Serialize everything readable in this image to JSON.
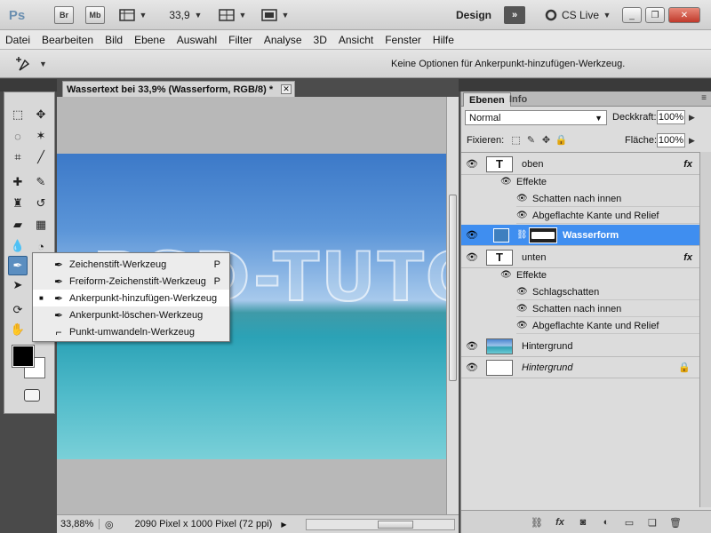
{
  "appbar": {
    "logo": "Ps",
    "bridge": "Br",
    "minibridge": "Mb",
    "zoom": "33,9",
    "workspace": "Design",
    "cslive": "CS Live",
    "minimize": "_",
    "restore": "❐",
    "close": "✕"
  },
  "menu": [
    "Datei",
    "Bearbeiten",
    "Bild",
    "Ebene",
    "Auswahl",
    "Filter",
    "Analyse",
    "3D",
    "Ansicht",
    "Fenster",
    "Hilfe"
  ],
  "options": {
    "text": "Keine Optionen für Ankerpunkt-hinzufügen-Werkzeug."
  },
  "document": {
    "tab_title": "Wassertext bei 33,9% (Wasserform, RGB/8) *",
    "artwork_text": "PSD-TUTO"
  },
  "flyout": [
    {
      "label": "Zeichenstift-Werkzeug",
      "key": "P",
      "icon": "pen-icon"
    },
    {
      "label": "Freiform-Zeichenstift-Werkzeug",
      "key": "P",
      "icon": "freeform-pen-icon"
    },
    {
      "label": "Ankerpunkt-hinzufügen-Werkzeug",
      "key": "",
      "icon": "add-anchor-icon"
    },
    {
      "label": "Ankerpunkt-löschen-Werkzeug",
      "key": "",
      "icon": "delete-anchor-icon"
    },
    {
      "label": "Punkt-umwandeln-Werkzeug",
      "key": "",
      "icon": "convert-point-icon"
    }
  ],
  "status": {
    "zoom": "33,88%",
    "info": "2090 Pixel x 1000 Pixel (72 ppi)"
  },
  "layers_panel": {
    "tab_layers": "Ebenen",
    "tab_info": "Info",
    "blend_mode": "Normal",
    "opacity_label": "Deckkraft:",
    "opacity_value": "100%",
    "lock_label": "Fixieren:",
    "fill_label": "Fläche:",
    "fill_value": "100%",
    "layers": {
      "oben": "oben",
      "effects_label": "Effekte",
      "oben_effect_1": "Schatten nach innen",
      "oben_effect_2": "Abgeflachte Kante und Relief",
      "wasserform": "Wasserform",
      "unten": "unten",
      "unten_effect_1": "Schlagschatten",
      "unten_effect_2": "Schatten nach innen",
      "unten_effect_3": "Abgeflachte Kante und Relief",
      "hintergrund_copy": "Hintergrund",
      "hintergrund": "Hintergrund",
      "fx": "fx",
      "text_thumb": "T"
    }
  }
}
